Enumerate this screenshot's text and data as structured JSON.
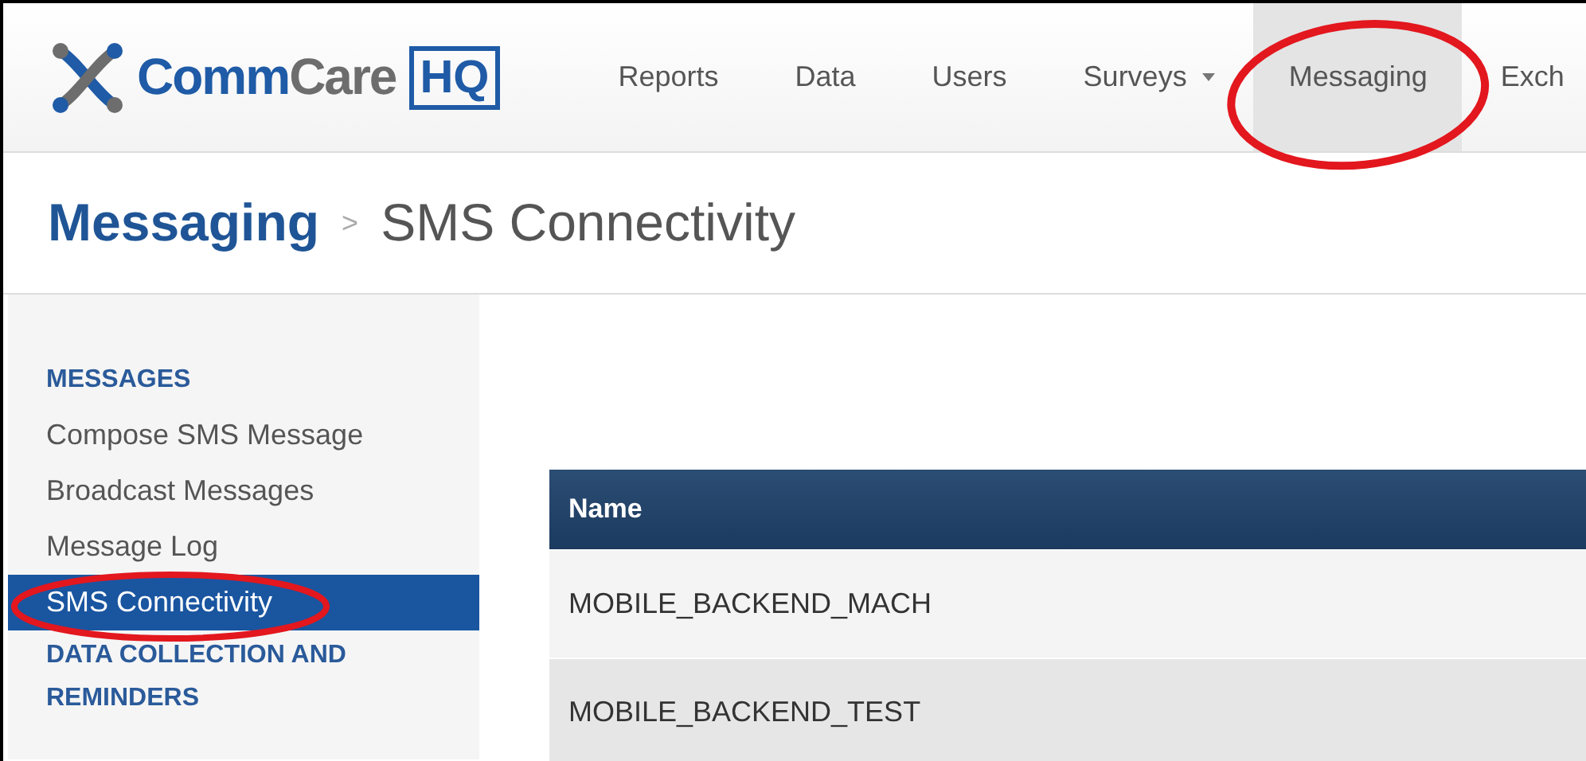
{
  "logo": {
    "word_a": "Comm",
    "word_b": "Care",
    "badge": "HQ"
  },
  "nav": [
    {
      "label": "Reports",
      "selected": false,
      "dropdown": false
    },
    {
      "label": "Data",
      "selected": false,
      "dropdown": false
    },
    {
      "label": "Users",
      "selected": false,
      "dropdown": false
    },
    {
      "label": "Surveys",
      "selected": false,
      "dropdown": true
    },
    {
      "label": "Messaging",
      "selected": true,
      "dropdown": false
    },
    {
      "label": "Exch",
      "selected": false,
      "dropdown": false
    }
  ],
  "breadcrumb": {
    "section": "Messaging",
    "separator": ">",
    "page": "SMS Connectivity"
  },
  "sidebar": [
    {
      "heading": "MESSAGES",
      "items": [
        {
          "label": "Compose SMS Message",
          "selected": false
        },
        {
          "label": "Broadcast Messages",
          "selected": false
        },
        {
          "label": "Message Log",
          "selected": false
        },
        {
          "label": "SMS Connectivity",
          "selected": true
        }
      ]
    },
    {
      "heading": "DATA COLLECTION AND REMINDERS"
    }
  ],
  "table": {
    "columns": [
      "Name"
    ],
    "rows": [
      [
        "MOBILE_BACKEND_MACH"
      ],
      [
        "MOBILE_BACKEND_TEST"
      ]
    ]
  }
}
